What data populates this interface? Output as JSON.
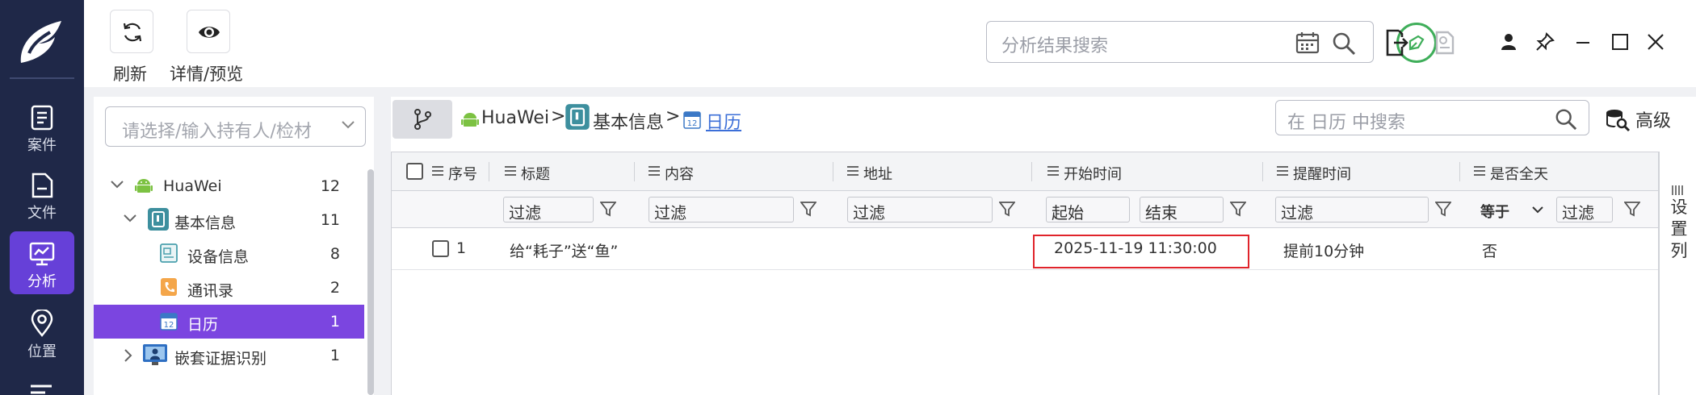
{
  "toolbar": {
    "refresh_label": "刷新",
    "preview_label": "详情/预览",
    "search_placeholder": "分析结果搜索"
  },
  "nav": {
    "items": [
      {
        "label": "案件",
        "icon": "case-icon",
        "active": false
      },
      {
        "label": "文件",
        "icon": "file-icon",
        "active": false
      },
      {
        "label": "分析",
        "icon": "analysis-icon",
        "active": true
      },
      {
        "label": "位置",
        "icon": "location-icon",
        "active": false
      }
    ]
  },
  "tree": {
    "combo_placeholder": "请选择/输入持有人/检材",
    "items": [
      {
        "label": "HuaWei",
        "count": "12",
        "icon": "android-icon",
        "expanded": true
      },
      {
        "label": "基本信息",
        "count": "11",
        "icon": "basic-info-icon",
        "expanded": true
      },
      {
        "label": "设备信息",
        "count": "8",
        "icon": "device-info-icon"
      },
      {
        "label": "通讯录",
        "count": "2",
        "icon": "contacts-icon"
      },
      {
        "label": "日历",
        "count": "1",
        "icon": "calendar-icon",
        "selected": true
      },
      {
        "label": "嵌套证据识别",
        "count": "1",
        "icon": "nested-evidence-icon",
        "expanded": false
      }
    ]
  },
  "breadcrumb": {
    "items": [
      "HuaWei",
      "基本信息",
      "日历"
    ],
    "separator": ">"
  },
  "table_search": {
    "placeholder": "在 日历 中搜索"
  },
  "advanced_label": "高级",
  "table": {
    "columns": [
      "序号",
      "标题",
      "内容",
      "地址",
      "开始时间",
      "提醒时间",
      "是否全天"
    ],
    "filter_placeholder": "过滤",
    "start_placeholder": "起始",
    "end_placeholder": "结束",
    "equals_label": "等于",
    "rows": [
      {
        "index": "1",
        "title": "给“耗子”送“鱼”",
        "content": "",
        "address": "",
        "start_time": "2025-11-19 11:30:00",
        "reminder": "提前10分钟",
        "all_day": "否"
      }
    ]
  },
  "settings_column_label": "设置列",
  "colors": {
    "nav_bg": "#1f2848",
    "nav_active": "#6640d8",
    "tree_selected": "#7b45e0",
    "highlight_border": "#e0242b",
    "round_button": "#3fae5a",
    "link": "#3c6fd8"
  }
}
